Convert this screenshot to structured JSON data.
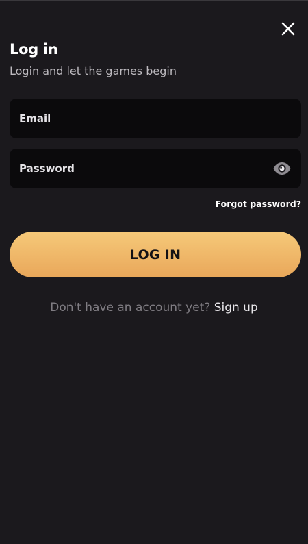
{
  "header": {
    "title": "Log in",
    "subtitle": "Login and let the games begin",
    "close_icon": "close-icon"
  },
  "form": {
    "email": {
      "placeholder": "Email",
      "value": ""
    },
    "password": {
      "placeholder": "Password",
      "value": "",
      "toggle_icon": "eye-icon"
    },
    "forgot_password_label": "Forgot password?",
    "submit_label": "LOG IN"
  },
  "footer": {
    "prompt": "Don't have an account yet?",
    "signup_label": "Sign up"
  },
  "colors": {
    "background": "#1b191d",
    "field_background": "#0b0a0c",
    "button_gradient_top": "#f6c979",
    "button_gradient_bottom": "#e9a75a",
    "muted_text": "#807d83"
  }
}
